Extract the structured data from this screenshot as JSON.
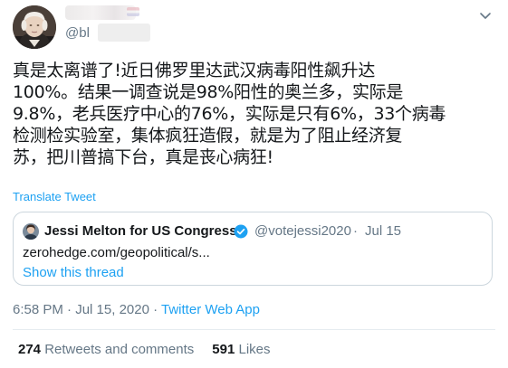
{
  "author": {
    "handle_prefix": "@bl"
  },
  "tweet": {
    "lines": [
      "真是太离谱了!近日佛罗里达武汉病毒阳性飙升达",
      "100%。结果一调查说是98%阳性的奥兰多，实际是",
      "9.8%，老兵医疗中心的76%，实际是只有6%，33个病毒",
      "检测检实验室，集体疯狂造假，就是为了阻止经济复",
      "苏，把川普搞下台，真是丧心病狂!"
    ],
    "translate_label": "Translate Tweet"
  },
  "quoted": {
    "name": "Jessi Melton for US Congress",
    "handle": "@votejessi2020",
    "separator": "·",
    "date": "Jul 15",
    "link": "zerohedge.com/geopolitical/s...",
    "show_thread": "Show this thread"
  },
  "meta": {
    "time": "6:58 PM",
    "separator": " · ",
    "date": "Jul 15, 2020",
    "source": "Twitter Web App"
  },
  "stats": {
    "retweets_count": "274",
    "retweets_label": "Retweets and comments",
    "likes_count": "591",
    "likes_label": "Likes"
  },
  "icons": {
    "more": "chevron-down-icon",
    "verified": "verified-badge-icon"
  },
  "colors": {
    "link": "#1da1f2",
    "muted": "#657786",
    "text": "#14171a",
    "border": "#ccd6dd"
  }
}
